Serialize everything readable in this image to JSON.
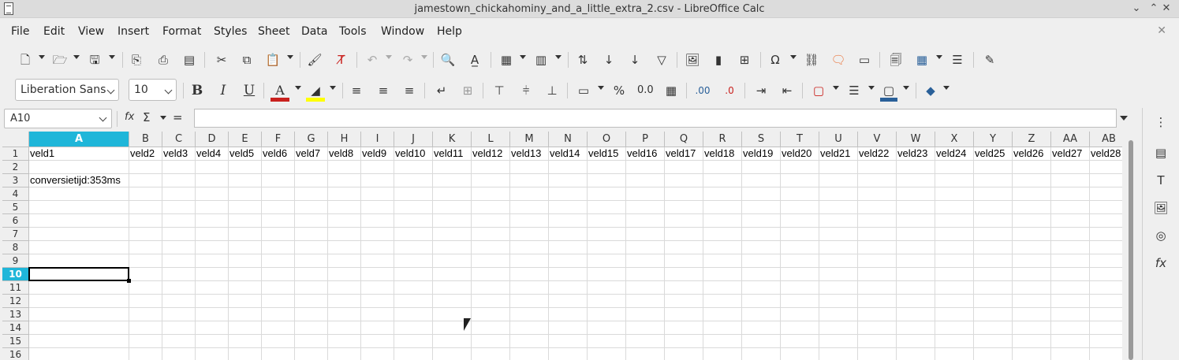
{
  "window": {
    "title": "jamestown_chickahominy_and_a_little_extra_2.csv - LibreOffice Calc"
  },
  "menu": [
    "File",
    "Edit",
    "View",
    "Insert",
    "Format",
    "Styles",
    "Sheet",
    "Data",
    "Tools",
    "Window",
    "Help"
  ],
  "formatting": {
    "font_name": "Liberation Sans",
    "font_size": "10"
  },
  "formula_bar": {
    "name_box": "A10",
    "fx": "fx",
    "sigma": "Σ",
    "equals": "=",
    "content": ""
  },
  "columns": [
    "A",
    "B",
    "C",
    "D",
    "E",
    "F",
    "G",
    "H",
    "I",
    "J",
    "K",
    "L",
    "M",
    "N",
    "O",
    "P",
    "Q",
    "R",
    "S",
    "T",
    "U",
    "V",
    "W",
    "X",
    "Y",
    "Z",
    "AA",
    "AB"
  ],
  "rows": [
    "1",
    "2",
    "3",
    "4",
    "5",
    "6",
    "7",
    "8",
    "9",
    "10",
    "11",
    "12",
    "13",
    "14",
    "15",
    "16"
  ],
  "selected": {
    "column": "A",
    "row": "10",
    "cell": "A10"
  },
  "cells": {
    "row1": [
      "veld1",
      "veld2",
      "veld3",
      "veld4",
      "veld5",
      "veld6",
      "veld7",
      "veld8",
      "veld9",
      "veld10",
      "veld11",
      "veld12",
      "veld13",
      "veld14",
      "veld15",
      "veld16",
      "veld17",
      "veld18",
      "veld19",
      "veld20",
      "veld21",
      "veld22",
      "veld23",
      "veld24",
      "veld25",
      "veld26",
      "veld27",
      "veld28"
    ],
    "a3": "conversietijd:353ms"
  },
  "colors": {
    "selection_header": "#1fb6d9",
    "font_color_bar": "#c9211e",
    "highlight_bar": "#ffff00",
    "border_color_bar": "#2a6099"
  },
  "icons": [
    "new-icon",
    "open-icon",
    "save-icon",
    "export-pdf-icon",
    "print-icon",
    "print-preview-icon",
    "cut-icon",
    "copy-icon",
    "paste-icon",
    "clone-formatting-icon",
    "clear-formatting-icon",
    "undo-icon",
    "redo-icon",
    "find-replace-icon",
    "spelling-icon",
    "row-icon",
    "column-icon",
    "sort-icon",
    "sort-ascending-icon",
    "sort-descending-icon",
    "autofilter-icon",
    "image-icon",
    "chart-icon",
    "pivot-table-icon",
    "special-character-icon",
    "hyperlink-icon",
    "comment-icon",
    "headers-footers-icon",
    "define-print-area-icon",
    "freeze-icon",
    "split-window-icon",
    "show-draw-functions-icon"
  ]
}
